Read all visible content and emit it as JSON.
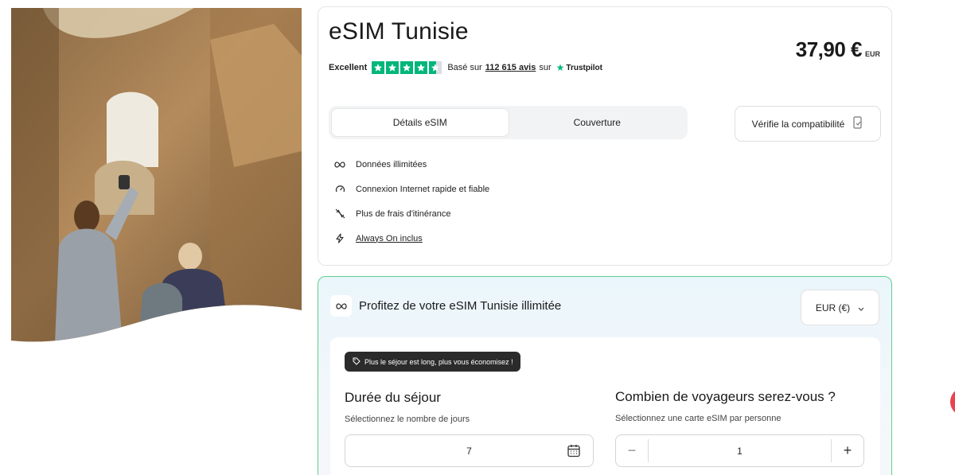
{
  "product": {
    "title": "eSIM Tunisie",
    "price": "37,90 €",
    "currency_code": "EUR",
    "rating_label": "Excellent",
    "stars": 4.5,
    "based_on": "Basé sur",
    "reviews_count": "112 615 avis",
    "on": "sur",
    "trustpilot": "Trustpilot"
  },
  "tabs": [
    {
      "label": "Détails eSIM",
      "active": true
    },
    {
      "label": "Couverture",
      "active": false
    }
  ],
  "compat_button": {
    "label": "Vérifie la compatibilité"
  },
  "features": [
    {
      "icon": "infinity-icon",
      "label": "Données illimitées"
    },
    {
      "icon": "speedometer-icon",
      "label": "Connexion Internet rapide et fiable"
    },
    {
      "icon": "no-roaming-icon",
      "label": "Plus de frais d'itinérance"
    },
    {
      "icon": "lightning-icon",
      "label": "Always On inclus",
      "link": true
    }
  ],
  "offer": {
    "title": "Profitez de votre eSIM Tunisie illimitée",
    "currency_select": "EUR (€)",
    "promo": "Plus le séjour est long, plus vous économisez !",
    "duration": {
      "title": "Durée du séjour",
      "subtitle": "Sélectionnez le nombre de jours",
      "value": "7"
    },
    "travelers": {
      "title": "Combien de voyageurs serez-vous ?",
      "subtitle": "Sélectionnez une carte eSIM par personne",
      "value": "1",
      "minus": "−",
      "plus": "+"
    }
  },
  "colors": {
    "accent_green": "#00b67a",
    "offer_border": "#5fd08c",
    "promo_bg": "#2b2b2b",
    "fab": "#e8444f"
  }
}
